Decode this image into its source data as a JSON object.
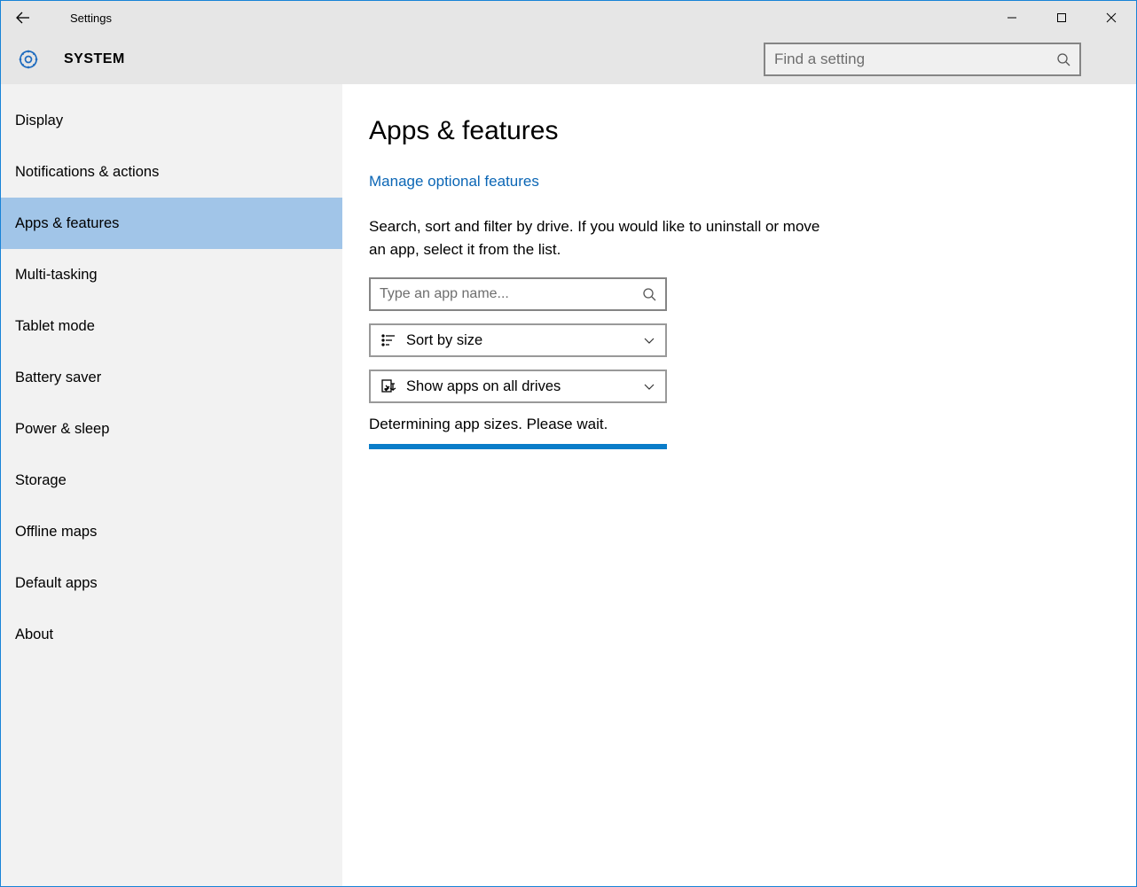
{
  "window": {
    "title": "Settings"
  },
  "header": {
    "section": "SYSTEM",
    "search_placeholder": "Find a setting"
  },
  "sidebar": {
    "items": [
      {
        "label": "Display"
      },
      {
        "label": "Notifications & actions"
      },
      {
        "label": "Apps & features",
        "selected": true
      },
      {
        "label": "Multi-tasking"
      },
      {
        "label": "Tablet mode"
      },
      {
        "label": "Battery saver"
      },
      {
        "label": "Power & sleep"
      },
      {
        "label": "Storage"
      },
      {
        "label": "Offline maps"
      },
      {
        "label": "Default apps"
      },
      {
        "label": "About"
      }
    ]
  },
  "content": {
    "heading": "Apps & features",
    "link": "Manage optional features",
    "description": "Search, sort and filter by drive. If you would like to uninstall or move an app, select it from the list.",
    "app_search_placeholder": "Type an app name...",
    "sort_label": "Sort by size",
    "drive_label": "Show apps on all drives",
    "status": "Determining app sizes. Please wait."
  }
}
